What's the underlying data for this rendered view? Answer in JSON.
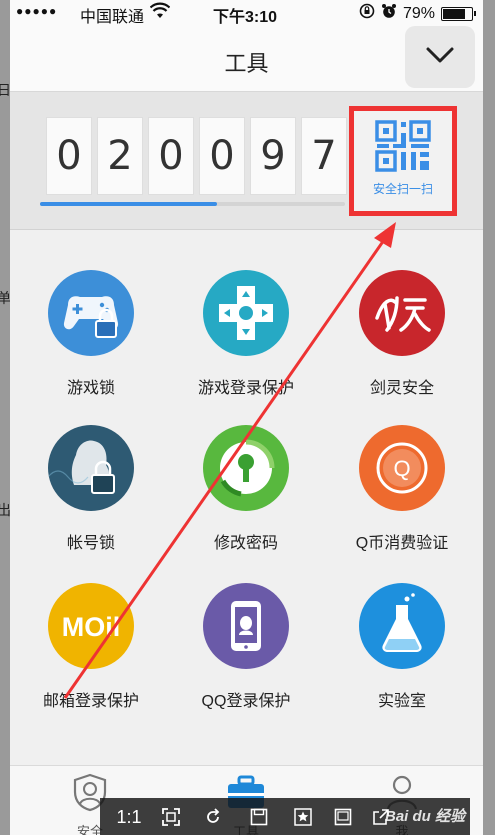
{
  "status_bar": {
    "signal": "●●●●●",
    "carrier": "中国联通",
    "time": "下午3:10",
    "battery": "79%",
    "battery_level": 0.79
  },
  "header": {
    "title": "工具",
    "collapse_icon": "chevron-down-icon"
  },
  "counter": {
    "digits": [
      "0",
      "2",
      "0",
      "0",
      "9",
      "7"
    ],
    "progress": 0.58,
    "scan_label": "安全扫一扫",
    "scan_icon": "qr-code-icon"
  },
  "tools": [
    {
      "label": "游戏锁",
      "icon": "gamepad-lock-icon",
      "color": "#3d8fd8"
    },
    {
      "label": "游戏登录保护",
      "icon": "dpad-icon",
      "color": "#26a9c4"
    },
    {
      "label": "剑灵安全",
      "icon": "jianling-logo-icon",
      "color": "#c8262c"
    },
    {
      "label": "帐号锁",
      "icon": "account-lock-icon",
      "color": "#2e5a73"
    },
    {
      "label": "修改密码",
      "icon": "keyhole-icon",
      "color": "#58b83e"
    },
    {
      "label": "Q币消费验证",
      "icon": "q-coin-icon",
      "color": "#ee6a2e"
    },
    {
      "label": "邮箱登录保护",
      "icon": "mail-logo-icon",
      "color": "#f0b400"
    },
    {
      "label": "QQ登录保护",
      "icon": "phone-qq-icon",
      "color": "#6a5aa8"
    },
    {
      "label": "实验室",
      "icon": "flask-icon",
      "color": "#1e90dd"
    }
  ],
  "tabbar": {
    "tabs": [
      {
        "label": "安全",
        "icon": "shield-user-icon"
      },
      {
        "label": "工具",
        "icon": "toolbox-icon"
      },
      {
        "label": "我",
        "icon": "person-icon"
      }
    ]
  },
  "viewer": {
    "ratio_label": "1:1",
    "watermark": "Bai du 经验"
  },
  "colors": {
    "accent": "#3a8ee6",
    "highlight": "#ee3333"
  }
}
